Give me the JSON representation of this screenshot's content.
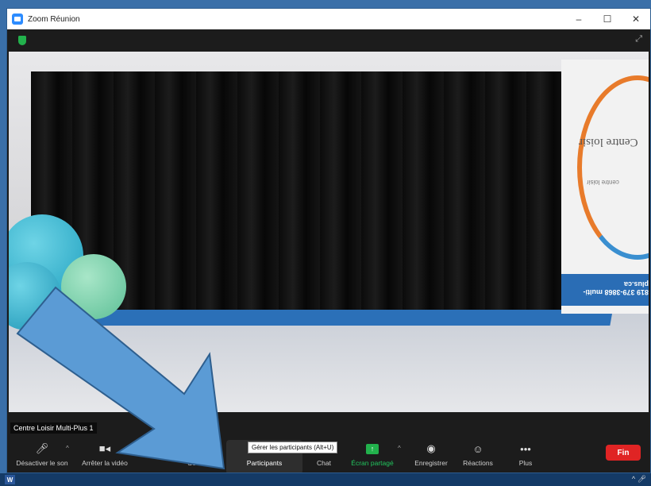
{
  "window": {
    "title": "Zoom Réunion",
    "controls": {
      "minimize": "–",
      "maximize": "☐",
      "close": "✕"
    }
  },
  "video": {
    "participant_name": "Centre Loisir Multi-Plus 1",
    "banner_text": "Centre loisir",
    "banner_subtext": "centre loisir",
    "banner_contact": "819 379-3868 multi-plus.ca"
  },
  "toolbar": {
    "mute_label": "Désactiver le son",
    "video_label": "Arrêter la vidéo",
    "security_label": "Sécurité",
    "participants_label": "Participants",
    "chat_label": "Chat",
    "share_label": "Écran partagé",
    "record_label": "Enregistrer",
    "reactions_label": "Réactions",
    "more_label": "Plus",
    "end_label": "Fin",
    "tooltip": "Gérer les participants (Alt+U)"
  },
  "colors": {
    "accent": "#2d8cff",
    "end": "#e02424",
    "share": "#22b14c",
    "annotation_arrow": "#5b9bd5"
  },
  "annotation": "Large blue arrow pointing to the Participants button"
}
